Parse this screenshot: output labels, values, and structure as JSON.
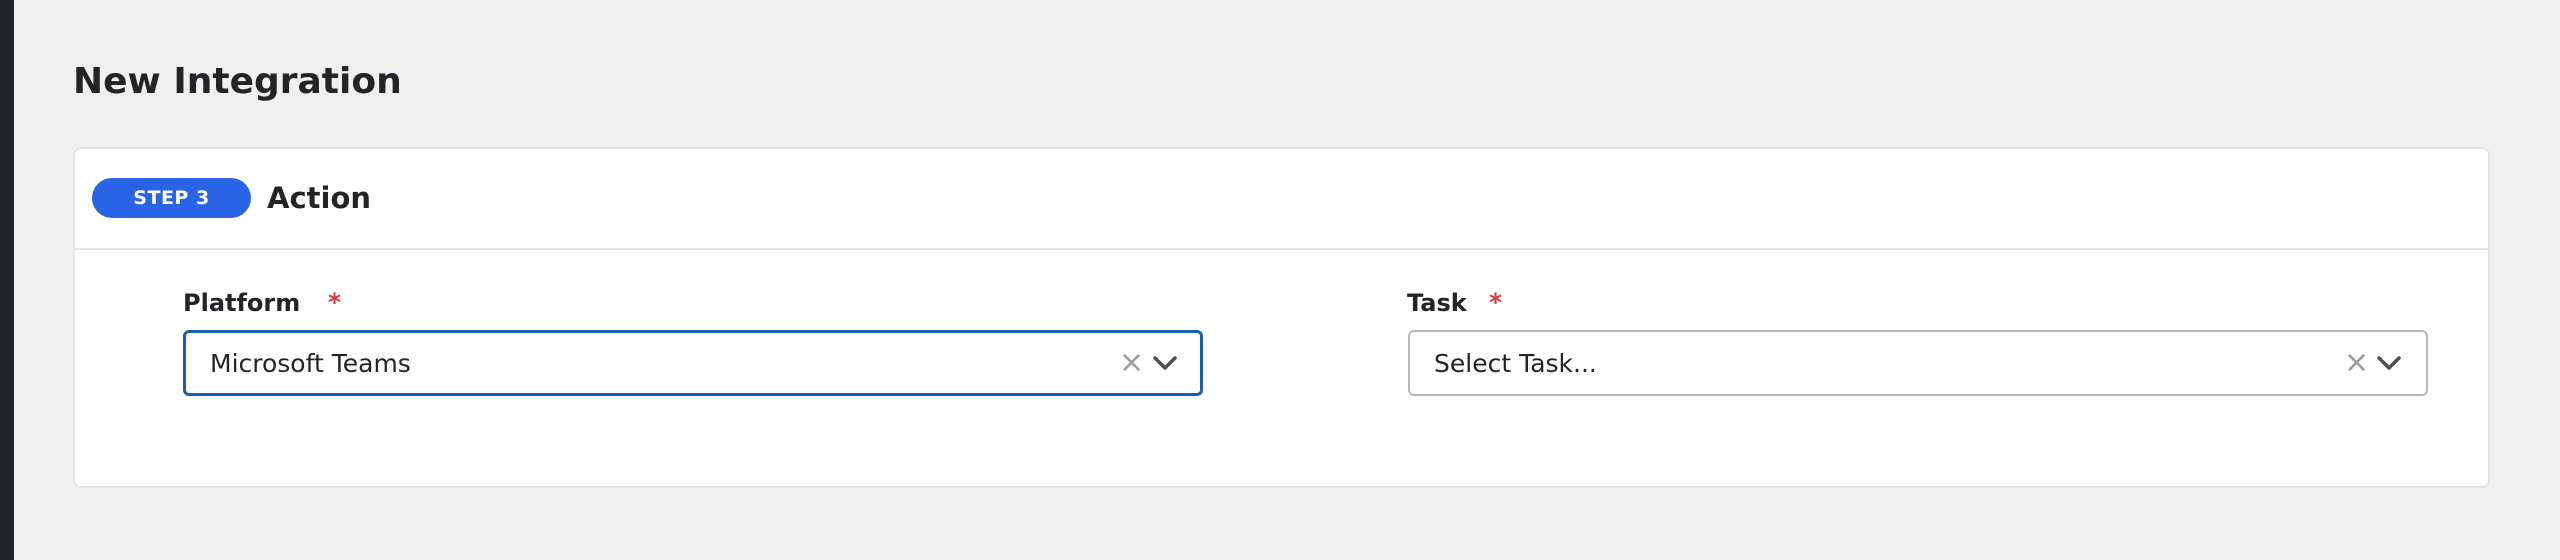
{
  "page": {
    "title": "New Integration"
  },
  "step": {
    "badge": "STEP 3",
    "title": "Action"
  },
  "form": {
    "platform": {
      "label": "Platform",
      "required_mark": "*",
      "value": "Microsoft Teams",
      "clear_icon": "close-icon",
      "dropdown_icon": "chevron-down-icon"
    },
    "task": {
      "label": "Task",
      "required_mark": "*",
      "placeholder": "Select Task...",
      "clear_icon": "close-icon",
      "dropdown_icon": "chevron-down-icon"
    }
  },
  "colors": {
    "badge": "#2a64e6",
    "required": "#dc3545",
    "focus_border": "#1c5fb1"
  }
}
